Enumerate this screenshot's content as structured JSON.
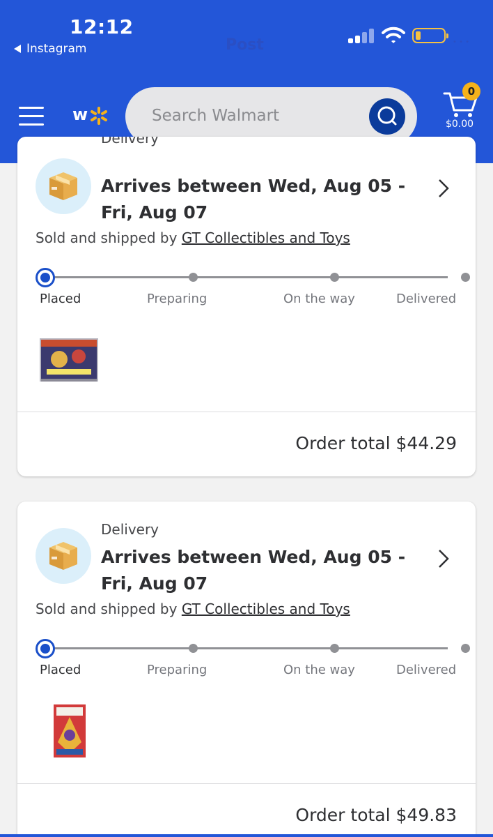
{
  "status_bar": {
    "time": "12:12",
    "back_app": "Instagram",
    "obscured_title": "Post"
  },
  "header": {
    "search_placeholder": "Search Walmart",
    "cart_count": "0",
    "cart_total": "$0.00",
    "brand_color": "#2356d8",
    "accent_color": "#f5b21b"
  },
  "orders": [
    {
      "method": "Delivery",
      "arrival": "Arrives between Wed, Aug 05 - Fri, Aug 07",
      "seller_prefix": "Sold and shipped by",
      "seller": "GT Collectibles and Toys",
      "steps": [
        "Placed",
        "Preparing",
        "On the way",
        "Delivered"
      ],
      "active_step": "Placed",
      "total": "Order total $44.29"
    },
    {
      "method": "Delivery",
      "arrival": "Arrives between Wed, Aug 05 - Fri, Aug 07",
      "seller_prefix": "Sold and shipped by",
      "seller": "GT Collectibles and Toys",
      "steps": [
        "Placed",
        "Preparing",
        "On the way",
        "Delivered"
      ],
      "active_step": "Placed",
      "total": "Order total $49.83"
    }
  ],
  "icons": {
    "menu": "hamburger-menu-icon",
    "logo": "walmart-spark-icon",
    "search": "search-icon",
    "cart": "cart-icon",
    "package": "package-box-icon",
    "chevron": "chevron-right-icon"
  }
}
